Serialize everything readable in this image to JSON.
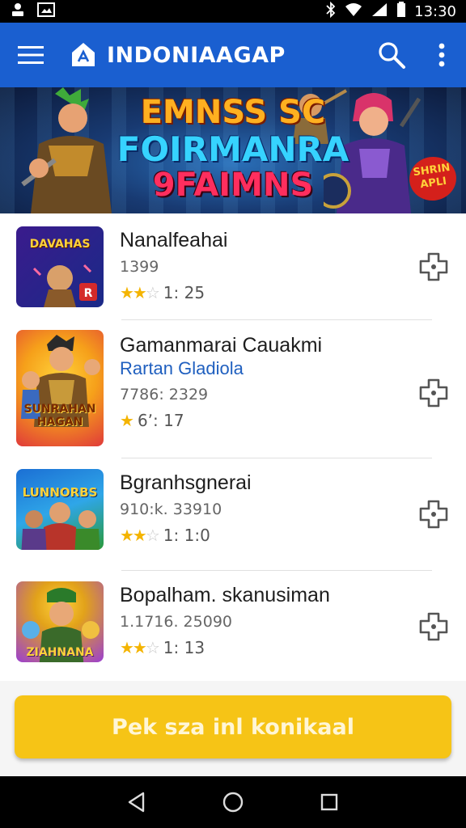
{
  "status_bar": {
    "time": "13:30",
    "icons": [
      "person-icon",
      "image-icon",
      "bluetooth-icon",
      "wifi-icon",
      "signal-icon",
      "battery-icon"
    ]
  },
  "app_bar": {
    "title": "INDONIAAGAP",
    "icons": [
      "menu-icon",
      "app-logo-icon",
      "search-icon",
      "more-vert-icon"
    ]
  },
  "banner": {
    "line1": "EMNSS SC",
    "line2": "FOIRMANRA",
    "line3": "9FAIMNS",
    "badge": "SHRIN APLI"
  },
  "games": [
    {
      "name": "Nanalfeahai",
      "subtitle": "",
      "meta": "1399",
      "stars": 2.5,
      "rating_text": "1: 25",
      "thumb_caption": "DAVAHAS",
      "thumb_colors": [
        "#3a1b8c",
        "#1a2a88"
      ]
    },
    {
      "name": "Gamanmarai Cauakmi",
      "subtitle": "Rartan Gladiola",
      "meta": "7786: 2329",
      "stars": 1,
      "rating_text": "6ʼ: 17",
      "thumb_caption": "SUNRAHAN HAGAN",
      "thumb_colors": [
        "#f6a01a",
        "#e03a3a"
      ]
    },
    {
      "name": "Bgranhsgnerai",
      "subtitle": "",
      "meta": "910:k. 33910",
      "stars": 2.5,
      "rating_text": "1: 1:0",
      "thumb_caption": "LUNNORBS",
      "thumb_colors": [
        "#1b6fd4",
        "#2a9a3a"
      ]
    },
    {
      "name": "Bopalham. skanusiman",
      "subtitle": "",
      "meta": "1.1716. 25090",
      "stars": 2.5,
      "rating_text": "1: 13",
      "thumb_caption": "ZIAHNANA",
      "thumb_colors": [
        "#9b3fd1",
        "#e2a21a"
      ]
    }
  ],
  "cta": {
    "label": "Pek sza inl konikaal"
  },
  "nav_bar": {
    "icons": [
      "back-icon",
      "home-icon",
      "recents-icon"
    ]
  },
  "colors": {
    "app_bar": "#1a5fd0",
    "cta": "#f6c416",
    "star": "#f4b400",
    "subtitle": "#1f5fbf"
  }
}
